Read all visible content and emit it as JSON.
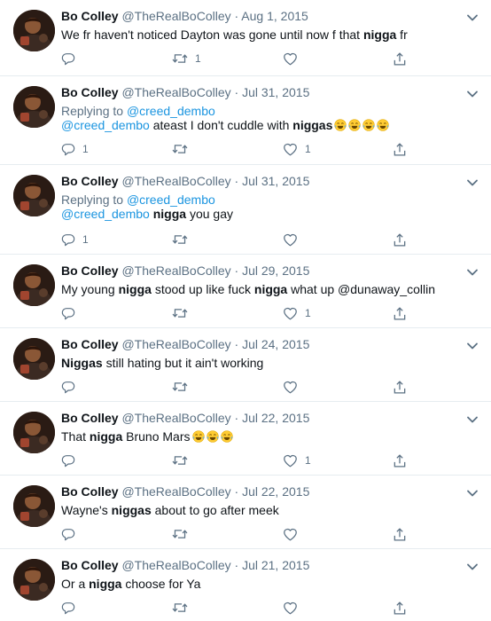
{
  "colors": {
    "text": "#0f1419",
    "secondary": "#5b7083",
    "link": "#1b95e0",
    "divider": "#e6ecf0"
  },
  "icons": {
    "reply": "reply-icon",
    "retweet": "retweet-icon",
    "like": "heart-icon",
    "share": "share-icon",
    "menu": "chevron-down-icon",
    "emoji": "face-with-tears-of-joy-emoji"
  },
  "tweets": [
    {
      "name": "Bo Colley",
      "meta": "@TheRealBoColley · Aug 1, 2015",
      "reply_to_prefix": "",
      "reply_to_handle": "",
      "mention": "",
      "seg1": "We fr haven't noticed Dayton was gone until now f that ",
      "bold1": "nigga",
      "seg2": " fr",
      "bold2": "",
      "seg3": "",
      "emoji_count": 0,
      "reply_count": "",
      "retweet_count": "1",
      "like_count": ""
    },
    {
      "name": "Bo Colley",
      "meta": "@TheRealBoColley · Jul 31, 2015",
      "reply_to_prefix": "Replying to ",
      "reply_to_handle": "@creed_dembo",
      "mention": "@creed_dembo",
      "seg1": " ateast I don't cuddle with ",
      "bold1": "niggas",
      "seg2": "",
      "bold2": "",
      "seg3": "",
      "emoji_count": 4,
      "reply_count": "1",
      "retweet_count": "",
      "like_count": "1"
    },
    {
      "name": "Bo Colley",
      "meta": "@TheRealBoColley · Jul 31, 2015",
      "reply_to_prefix": "Replying to ",
      "reply_to_handle": "@creed_dembo",
      "mention": "@creed_dembo",
      "seg1": " ",
      "bold1": "nigga",
      "seg2": " you gay",
      "bold2": "",
      "seg3": "",
      "emoji_count": 0,
      "reply_count": "1",
      "retweet_count": "",
      "like_count": ""
    },
    {
      "name": "Bo Colley",
      "meta": "@TheRealBoColley · Jul 29, 2015",
      "reply_to_prefix": "",
      "reply_to_handle": "",
      "mention": "",
      "seg1": "My young ",
      "bold1": "nigga",
      "seg2": " stood up like fuck ",
      "bold2": "nigga",
      "seg3": " what up @dunaway_collin",
      "emoji_count": 0,
      "reply_count": "",
      "retweet_count": "",
      "like_count": "1"
    },
    {
      "name": "Bo Colley",
      "meta": "@TheRealBoColley · Jul 24, 2015",
      "reply_to_prefix": "",
      "reply_to_handle": "",
      "mention": "",
      "seg1": "",
      "bold1": "Niggas",
      "seg2": " still hating but it ain't working",
      "bold2": "",
      "seg3": "",
      "emoji_count": 0,
      "reply_count": "",
      "retweet_count": "",
      "like_count": ""
    },
    {
      "name": "Bo Colley",
      "meta": "@TheRealBoColley · Jul 22, 2015",
      "reply_to_prefix": "",
      "reply_to_handle": "",
      "mention": "",
      "seg1": "That ",
      "bold1": "nigga",
      "seg2": " Bruno Mars",
      "bold2": "",
      "seg3": "",
      "emoji_count": 3,
      "reply_count": "",
      "retweet_count": "",
      "like_count": "1"
    },
    {
      "name": "Bo Colley",
      "meta": "@TheRealBoColley · Jul 22, 2015",
      "reply_to_prefix": "",
      "reply_to_handle": "",
      "mention": "",
      "seg1": "Wayne's ",
      "bold1": "niggas",
      "seg2": " about to go after meek",
      "bold2": "",
      "seg3": "",
      "emoji_count": 0,
      "reply_count": "",
      "retweet_count": "",
      "like_count": ""
    },
    {
      "name": "Bo Colley",
      "meta": "@TheRealBoColley · Jul 21, 2015",
      "reply_to_prefix": "",
      "reply_to_handle": "",
      "mention": "",
      "seg1": "Or a ",
      "bold1": "nigga",
      "seg2": " choose for Ya",
      "bold2": "",
      "seg3": "",
      "emoji_count": 0,
      "reply_count": "",
      "retweet_count": "",
      "like_count": ""
    }
  ]
}
